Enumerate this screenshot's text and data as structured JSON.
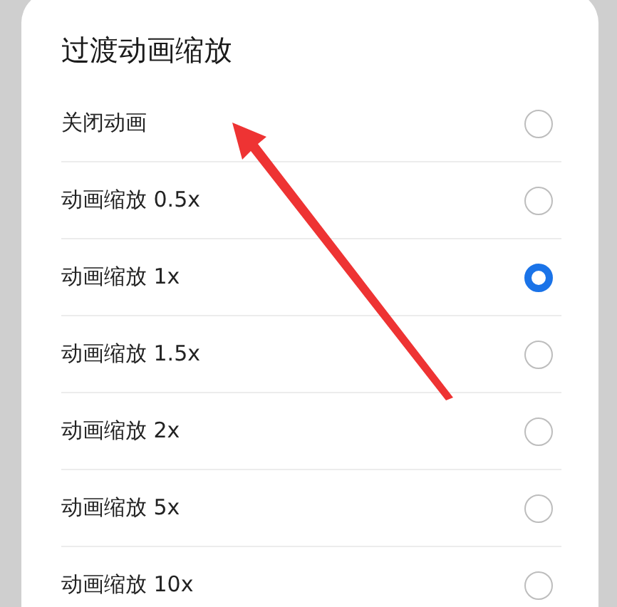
{
  "dialog": {
    "title": "过渡动画缩放",
    "options": [
      {
        "label": "关闭动画",
        "selected": false
      },
      {
        "label": "动画缩放 0.5x",
        "selected": false
      },
      {
        "label": "动画缩放 1x",
        "selected": true
      },
      {
        "label": "动画缩放 1.5x",
        "selected": false
      },
      {
        "label": "动画缩放 2x",
        "selected": false
      },
      {
        "label": "动画缩放 5x",
        "selected": false
      },
      {
        "label": "动画缩放 10x",
        "selected": false
      }
    ]
  }
}
